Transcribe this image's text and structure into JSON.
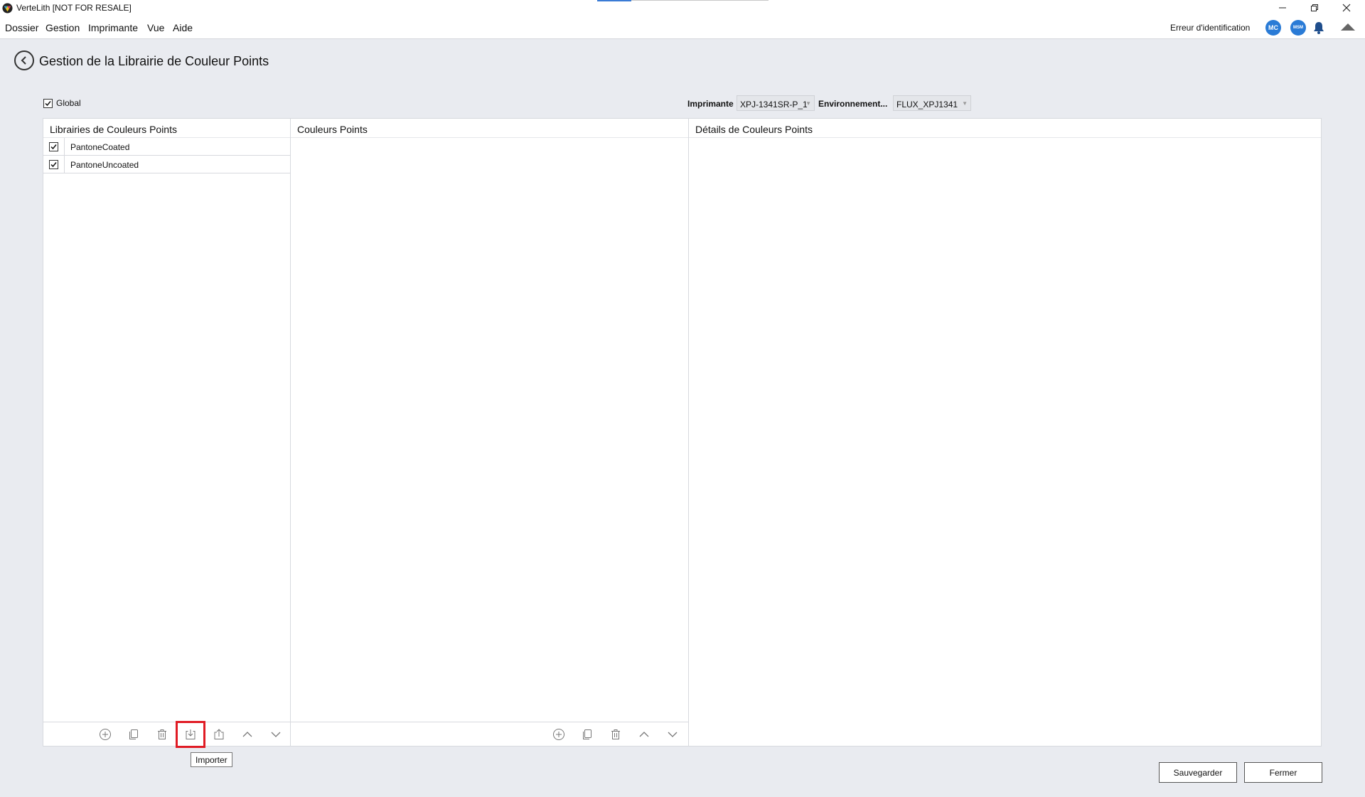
{
  "window": {
    "title": "VerteLith [NOT FOR RESALE]",
    "controls": {
      "minimize_icon": "minimize-icon",
      "restore_icon": "restore-icon",
      "close_icon": "close-icon"
    }
  },
  "menu": {
    "items": [
      "Dossier",
      "Gestion",
      "Imprimante",
      "Vue",
      "Aide"
    ],
    "status": "Erreur d'identification",
    "avatars": [
      "MC",
      "MSM"
    ]
  },
  "page": {
    "title": "Gestion de la Librairie de Couleur Points",
    "global_label": "Global",
    "global_checked": true,
    "printer_label": "Imprimante",
    "printer_value": "XPJ-1341SR-P_1",
    "env_label": "Environnement...",
    "env_value": "FLUX_XPJ1341"
  },
  "panels": {
    "libraries": {
      "header": "Librairies de Couleurs Points",
      "items": [
        {
          "name": "PantoneCoated",
          "checked": true
        },
        {
          "name": "PantoneUncoated",
          "checked": true
        }
      ]
    },
    "colors": {
      "header": "Couleurs Points"
    },
    "details": {
      "header": "Détails de Couleurs Points"
    }
  },
  "tooltip": "Importer",
  "buttons": {
    "save": "Sauvegarder",
    "close": "Fermer"
  },
  "colors": {
    "accent": "#2a7bd6",
    "highlight": "#e01b24",
    "background": "#e9ebf0"
  }
}
